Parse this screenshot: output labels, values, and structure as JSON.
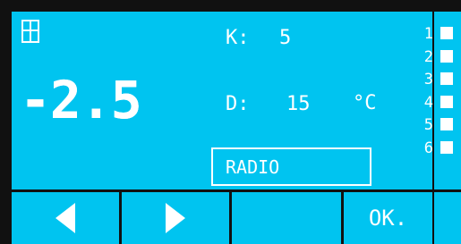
{
  "colors": {
    "panel": "#00c4f0",
    "text": "#ffffff",
    "background": "#111111"
  },
  "status": {
    "window_icon": "window-icon"
  },
  "main": {
    "value": "-2.5",
    "k_label": "K:",
    "k_value": "5",
    "d_label": "D:",
    "d_value": "15",
    "unit": "°C",
    "mode": "RADIO"
  },
  "sidebar": {
    "numbers": [
      "1",
      "2",
      "3",
      "4",
      "5",
      "6"
    ]
  },
  "buttons": {
    "left_icon": "arrow-left-icon",
    "right_icon": "arrow-right-icon",
    "ok_label": "OK."
  }
}
